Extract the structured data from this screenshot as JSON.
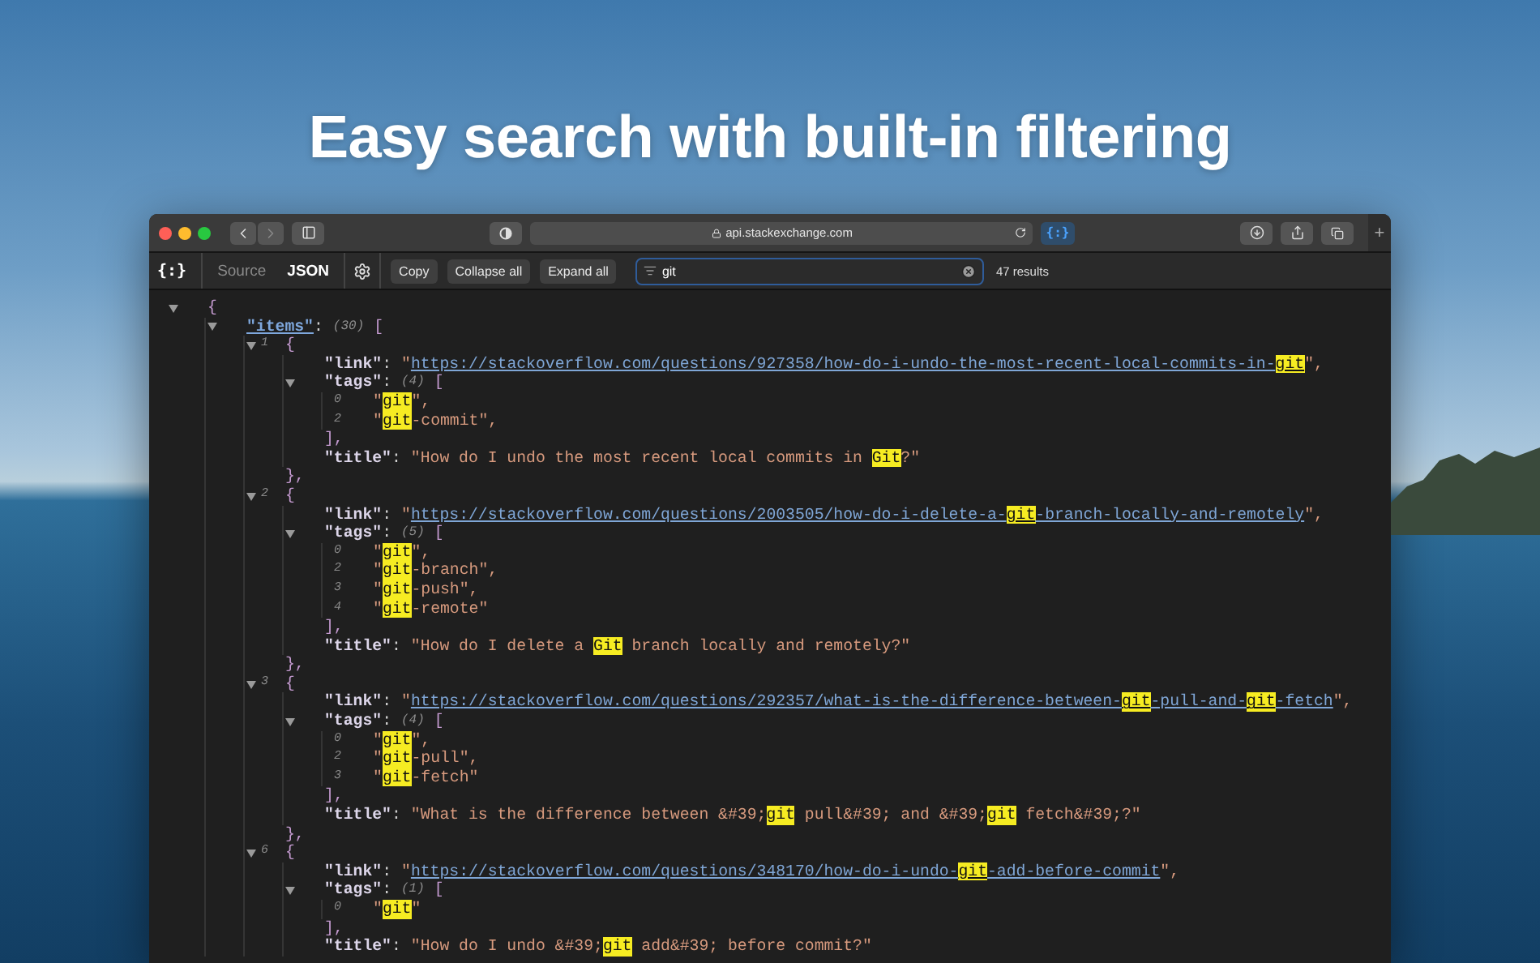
{
  "headline": "Easy search with built-in filtering",
  "browser": {
    "address": "api.stackexchange.com",
    "extension_label": "{:}",
    "new_tab_label": "+"
  },
  "viewer_toolbar": {
    "logo": "{:}",
    "tabs": [
      {
        "label": "Source",
        "selected": false
      },
      {
        "label": "JSON",
        "selected": true
      }
    ],
    "buttons": [
      "Copy",
      "Collapse all",
      "Expand all"
    ],
    "search": {
      "value": "git",
      "results": "47 results"
    }
  },
  "tree": {
    "expanded": true,
    "tokens": [
      {
        "kind": "bracket",
        "text": "{"
      }
    ],
    "children": [
      {
        "expanded": true,
        "tokens": [
          {
            "kind": "keylink",
            "text": "\"items\""
          },
          {
            "kind": "colon",
            "text": ":"
          },
          {
            "kind": "count",
            "text": "(30)"
          },
          {
            "kind": "bracket",
            "text": "["
          }
        ],
        "children": [
          {
            "expanded": true,
            "index": "1",
            "tokens": [
              {
                "kind": "bracket",
                "text": "{"
              }
            ],
            "close": [
              {
                "kind": "bracket",
                "text": "},"
              }
            ],
            "children": [
              {
                "tokens": [
                  {
                    "kind": "key",
                    "text": "\"link\""
                  },
                  {
                    "kind": "colon",
                    "text": ":"
                  },
                  {
                    "kind": "str",
                    "text": "\""
                  },
                  {
                    "kind": "url",
                    "text": "https://stackoverflow.com/questions/927358/how-do-i-undo-the-most-recent-local-commits-in-"
                  },
                  {
                    "kind": "urlmatch",
                    "text": "git"
                  },
                  {
                    "kind": "str",
                    "text": "\","
                  }
                ]
              },
              {
                "expanded": true,
                "tokens": [
                  {
                    "kind": "key",
                    "text": "\"tags\""
                  },
                  {
                    "kind": "colon",
                    "text": ":"
                  },
                  {
                    "kind": "count",
                    "text": "(4)"
                  },
                  {
                    "kind": "bracket",
                    "text": "["
                  }
                ],
                "close": [
                  {
                    "kind": "bracket",
                    "text": "],"
                  }
                ],
                "children": [
                  {
                    "index": "0",
                    "tokens": [
                      {
                        "kind": "str",
                        "text": "\""
                      },
                      {
                        "kind": "match",
                        "text": "git"
                      },
                      {
                        "kind": "str",
                        "text": "\","
                      }
                    ]
                  },
                  {
                    "index": "2",
                    "tokens": [
                      {
                        "kind": "str",
                        "text": "\""
                      },
                      {
                        "kind": "match",
                        "text": "git"
                      },
                      {
                        "kind": "str",
                        "text": "-commit\","
                      }
                    ]
                  }
                ]
              },
              {
                "tokens": [
                  {
                    "kind": "key",
                    "text": "\"title\""
                  },
                  {
                    "kind": "colon",
                    "text": ":"
                  },
                  {
                    "kind": "str",
                    "text": "\"How do I undo the most recent local commits in "
                  },
                  {
                    "kind": "match",
                    "text": "Git"
                  },
                  {
                    "kind": "str",
                    "text": "?\""
                  }
                ]
              }
            ]
          },
          {
            "expanded": true,
            "index": "2",
            "tokens": [
              {
                "kind": "bracket",
                "text": "{"
              }
            ],
            "close": [
              {
                "kind": "bracket",
                "text": "},"
              }
            ],
            "children": [
              {
                "tokens": [
                  {
                    "kind": "key",
                    "text": "\"link\""
                  },
                  {
                    "kind": "colon",
                    "text": ":"
                  },
                  {
                    "kind": "str",
                    "text": "\""
                  },
                  {
                    "kind": "url",
                    "text": "https://stackoverflow.com/questions/2003505/how-do-i-delete-a-"
                  },
                  {
                    "kind": "urlmatch",
                    "text": "git"
                  },
                  {
                    "kind": "url",
                    "text": "-branch-locally-and-remotely"
                  },
                  {
                    "kind": "str",
                    "text": "\","
                  }
                ]
              },
              {
                "expanded": true,
                "tokens": [
                  {
                    "kind": "key",
                    "text": "\"tags\""
                  },
                  {
                    "kind": "colon",
                    "text": ":"
                  },
                  {
                    "kind": "count",
                    "text": "(5)"
                  },
                  {
                    "kind": "bracket",
                    "text": "["
                  }
                ],
                "close": [
                  {
                    "kind": "bracket",
                    "text": "],"
                  }
                ],
                "children": [
                  {
                    "index": "0",
                    "tokens": [
                      {
                        "kind": "str",
                        "text": "\""
                      },
                      {
                        "kind": "match",
                        "text": "git"
                      },
                      {
                        "kind": "str",
                        "text": "\","
                      }
                    ]
                  },
                  {
                    "index": "2",
                    "tokens": [
                      {
                        "kind": "str",
                        "text": "\""
                      },
                      {
                        "kind": "match",
                        "text": "git"
                      },
                      {
                        "kind": "str",
                        "text": "-branch\","
                      }
                    ]
                  },
                  {
                    "index": "3",
                    "tokens": [
                      {
                        "kind": "str",
                        "text": "\""
                      },
                      {
                        "kind": "match",
                        "text": "git"
                      },
                      {
                        "kind": "str",
                        "text": "-push\","
                      }
                    ]
                  },
                  {
                    "index": "4",
                    "tokens": [
                      {
                        "kind": "str",
                        "text": "\""
                      },
                      {
                        "kind": "match",
                        "text": "git"
                      },
                      {
                        "kind": "str",
                        "text": "-remote\""
                      }
                    ]
                  }
                ]
              },
              {
                "tokens": [
                  {
                    "kind": "key",
                    "text": "\"title\""
                  },
                  {
                    "kind": "colon",
                    "text": ":"
                  },
                  {
                    "kind": "str",
                    "text": "\"How do I delete a "
                  },
                  {
                    "kind": "match",
                    "text": "Git"
                  },
                  {
                    "kind": "str",
                    "text": " branch locally and remotely?\""
                  }
                ]
              }
            ]
          },
          {
            "expanded": true,
            "index": "3",
            "tokens": [
              {
                "kind": "bracket",
                "text": "{"
              }
            ],
            "close": [
              {
                "kind": "bracket",
                "text": "},"
              }
            ],
            "children": [
              {
                "tokens": [
                  {
                    "kind": "key",
                    "text": "\"link\""
                  },
                  {
                    "kind": "colon",
                    "text": ":"
                  },
                  {
                    "kind": "str",
                    "text": "\""
                  },
                  {
                    "kind": "url",
                    "text": "https://stackoverflow.com/questions/292357/what-is-the-difference-between-"
                  },
                  {
                    "kind": "urlmatch",
                    "text": "git"
                  },
                  {
                    "kind": "url",
                    "text": "-pull-and-"
                  },
                  {
                    "kind": "urlmatch",
                    "text": "git"
                  },
                  {
                    "kind": "url",
                    "text": "-fetch"
                  },
                  {
                    "kind": "str",
                    "text": "\","
                  }
                ]
              },
              {
                "expanded": true,
                "tokens": [
                  {
                    "kind": "key",
                    "text": "\"tags\""
                  },
                  {
                    "kind": "colon",
                    "text": ":"
                  },
                  {
                    "kind": "count",
                    "text": "(4)"
                  },
                  {
                    "kind": "bracket",
                    "text": "["
                  }
                ],
                "close": [
                  {
                    "kind": "bracket",
                    "text": "],"
                  }
                ],
                "children": [
                  {
                    "index": "0",
                    "tokens": [
                      {
                        "kind": "str",
                        "text": "\""
                      },
                      {
                        "kind": "match",
                        "text": "git"
                      },
                      {
                        "kind": "str",
                        "text": "\","
                      }
                    ]
                  },
                  {
                    "index": "2",
                    "tokens": [
                      {
                        "kind": "str",
                        "text": "\""
                      },
                      {
                        "kind": "match",
                        "text": "git"
                      },
                      {
                        "kind": "str",
                        "text": "-pull\","
                      }
                    ]
                  },
                  {
                    "index": "3",
                    "tokens": [
                      {
                        "kind": "str",
                        "text": "\""
                      },
                      {
                        "kind": "match",
                        "text": "git"
                      },
                      {
                        "kind": "str",
                        "text": "-fetch\""
                      }
                    ]
                  }
                ]
              },
              {
                "tokens": [
                  {
                    "kind": "key",
                    "text": "\"title\""
                  },
                  {
                    "kind": "colon",
                    "text": ":"
                  },
                  {
                    "kind": "str",
                    "text": "\"What is the difference between &#39;"
                  },
                  {
                    "kind": "match",
                    "text": "git"
                  },
                  {
                    "kind": "str",
                    "text": " pull&#39; and &#39;"
                  },
                  {
                    "kind": "match",
                    "text": "git"
                  },
                  {
                    "kind": "str",
                    "text": " fetch&#39;?\""
                  }
                ]
              }
            ]
          },
          {
            "expanded": true,
            "index": "6",
            "tokens": [
              {
                "kind": "bracket",
                "text": "{"
              }
            ],
            "children": [
              {
                "tokens": [
                  {
                    "kind": "key",
                    "text": "\"link\""
                  },
                  {
                    "kind": "colon",
                    "text": ":"
                  },
                  {
                    "kind": "str",
                    "text": "\""
                  },
                  {
                    "kind": "url",
                    "text": "https://stackoverflow.com/questions/348170/how-do-i-undo-"
                  },
                  {
                    "kind": "urlmatch",
                    "text": "git"
                  },
                  {
                    "kind": "url",
                    "text": "-add-before-commit"
                  },
                  {
                    "kind": "str",
                    "text": "\","
                  }
                ]
              },
              {
                "expanded": true,
                "tokens": [
                  {
                    "kind": "key",
                    "text": "\"tags\""
                  },
                  {
                    "kind": "colon",
                    "text": ":"
                  },
                  {
                    "kind": "count",
                    "text": "(1)"
                  },
                  {
                    "kind": "bracket",
                    "text": "["
                  }
                ],
                "close": [
                  {
                    "kind": "bracket",
                    "text": "],"
                  }
                ],
                "children": [
                  {
                    "index": "0",
                    "tokens": [
                      {
                        "kind": "str",
                        "text": "\""
                      },
                      {
                        "kind": "match",
                        "text": "git"
                      },
                      {
                        "kind": "str",
                        "text": "\""
                      }
                    ]
                  }
                ]
              },
              {
                "tokens": [
                  {
                    "kind": "key",
                    "text": "\"title\""
                  },
                  {
                    "kind": "colon",
                    "text": ":"
                  },
                  {
                    "kind": "str",
                    "text": "\"How do I undo &#39;"
                  },
                  {
                    "kind": "match",
                    "text": "git"
                  },
                  {
                    "kind": "str",
                    "text": " add&#39; before commit?\""
                  }
                ]
              }
            ]
          }
        ]
      }
    ]
  }
}
